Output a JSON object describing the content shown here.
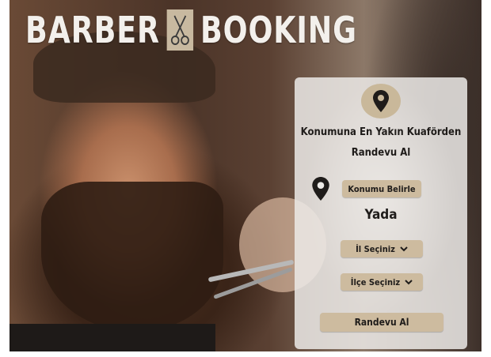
{
  "brand": {
    "left": "BARBER",
    "right": "BOOKING",
    "mark_icon": "scissors-icon"
  },
  "panel": {
    "pin_icon": "location-pin-icon",
    "headline_line1": "Konumuna En Yakın Kuaförden",
    "headline_line2": "Randevu Al",
    "locate_label": "Konumu Belirle",
    "or_label": "Yada",
    "province_label": "İl Seçiniz",
    "district_label": "İlçe Seçiniz",
    "submit_label": "Randevu Al"
  },
  "colors": {
    "button": "#cdbb9f",
    "panel": "#eceae7",
    "text": "#1f1c1a"
  }
}
